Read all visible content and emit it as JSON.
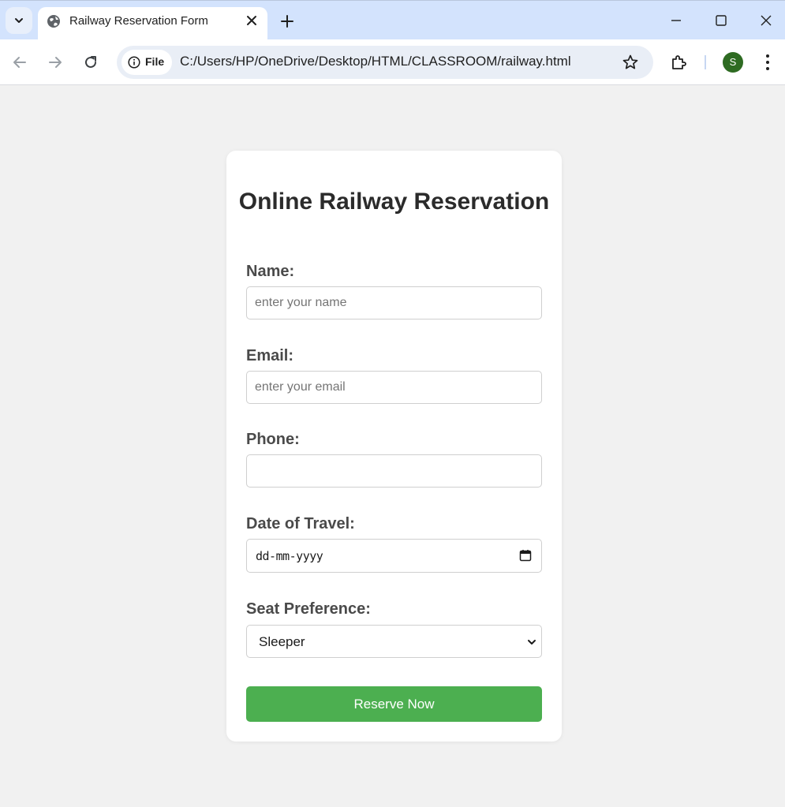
{
  "browser": {
    "tab_title": "Railway Reservation Form",
    "chip_label": "File",
    "url": "C:/Users/HP/OneDrive/Desktop/HTML/CLASSROOM/railway.html",
    "profile_initial": "S",
    "profile_color": "#2e6b22",
    "accent": "#d3e3fd"
  },
  "form": {
    "title": "Online Railway Reservation",
    "fields": {
      "name": {
        "label": "Name:",
        "placeholder": "enter your name"
      },
      "email": {
        "label": "Email:",
        "placeholder": "enter your email"
      },
      "phone": {
        "label": "Phone:",
        "placeholder": ""
      },
      "date": {
        "label": "Date of Travel:",
        "value": "dd-mm-yyyy"
      },
      "seat": {
        "label": "Seat Preference:",
        "value": "Sleeper"
      }
    },
    "submit_label": "Reserve Now",
    "submit_color": "#4caf50"
  }
}
